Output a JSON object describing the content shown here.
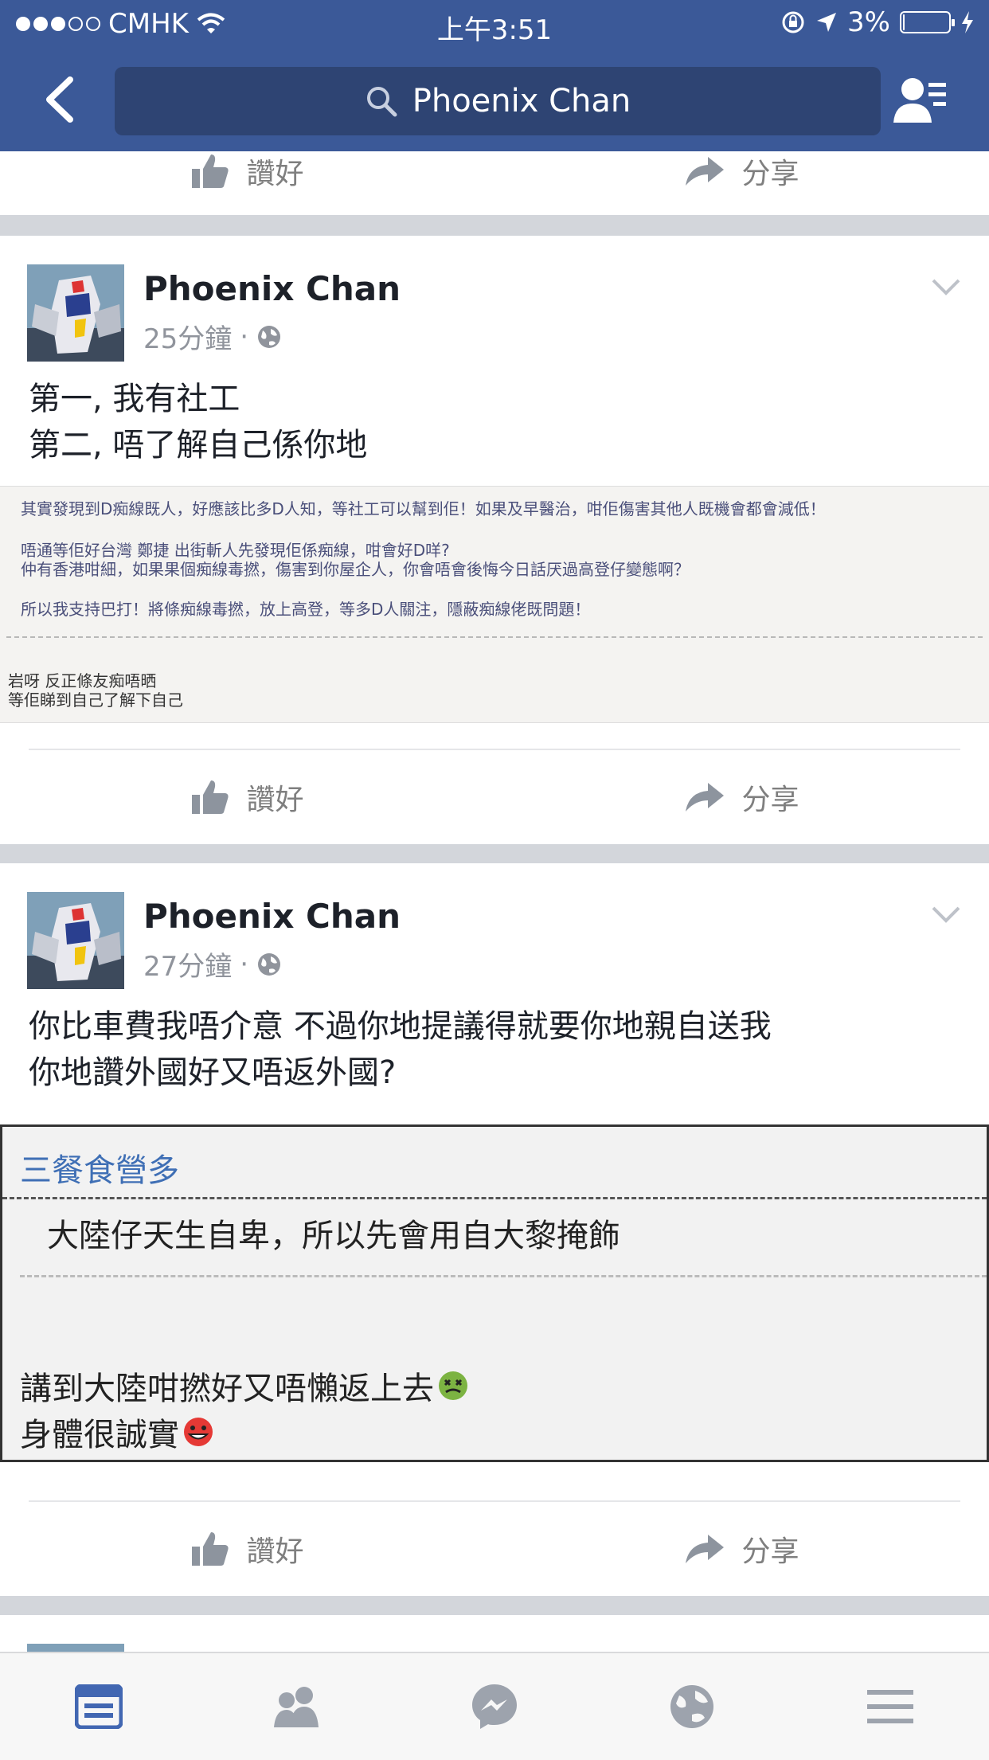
{
  "status_bar": {
    "carrier": "CMHK",
    "time": "上午3:51",
    "battery": "3%",
    "battery_level": 0.03
  },
  "nav": {
    "search_text": "Phoenix Chan"
  },
  "actions": {
    "like": "讚好",
    "share": "分享"
  },
  "posts": [
    {
      "author": "Phoenix Chan",
      "time": "25分鐘",
      "lines": [
        "第一, 我有社工",
        "第二, 唔了解自己係你地"
      ],
      "screenshot": {
        "lines": [
          "其實發現到D痴線既人，好應該比多D人知，等社工可以幫到佢！如果及早醫治，咁佢傷害其他人既機會都會減低！",
          "唔通等佢好台灣 鄭捷 出街斬人先發現佢係痴線，咁會好D咩?",
          "仲有香港咁細，如果果個痴線毒撚，傷害到你屋企人，你會唔會後悔今日話厌過高登仔變態啊？",
          "所以我支持巴打！將條痴線毒撚，放上高登，等多D人關注，隱蔽痴線佬既問題！",
          "岩呀 反正條友痴唔晒",
          "等佢睇到自己了解下自己"
        ]
      }
    },
    {
      "author": "Phoenix Chan",
      "time": "27分鐘",
      "lines": [
        "你比車費我唔介意 不過你地提議得就要你地親自送我",
        "你地讚外國好又唔返外國?"
      ],
      "screenshot": {
        "lines": [
          "三餐食營多",
          "大陸仔天生自卑，所以先會用自大黎掩飾",
          "講到大陸咁撚好又唔懶返上去",
          "身體很誠實"
        ]
      }
    }
  ]
}
